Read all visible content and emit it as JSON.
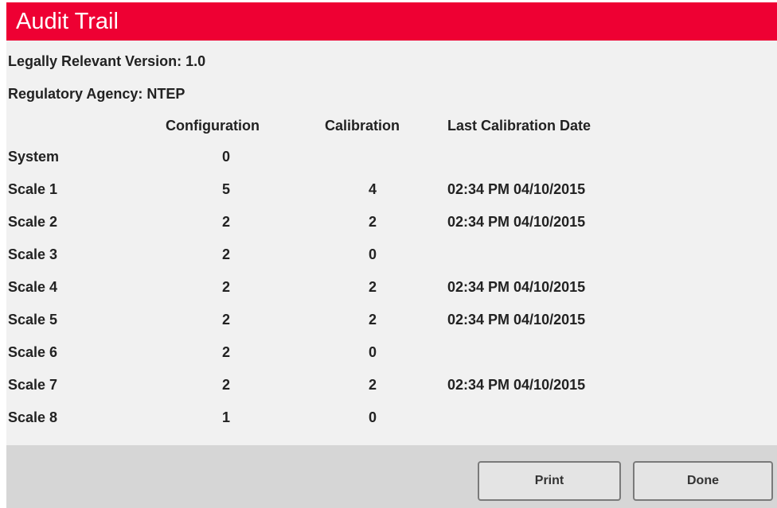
{
  "window": {
    "title": "Audit Trail"
  },
  "info": {
    "version_line": "Legally Relevant Version: 1.0",
    "agency_line": "Regulatory Agency: NTEP"
  },
  "table": {
    "headers": {
      "configuration": "Configuration",
      "calibration": "Calibration",
      "last_calibration_date": "Last Calibration Date"
    },
    "rows": [
      {
        "name": "System",
        "configuration": "0",
        "calibration": "",
        "date": ""
      },
      {
        "name": "Scale 1",
        "configuration": "5",
        "calibration": "4",
        "date": "02:34 PM 04/10/2015"
      },
      {
        "name": "Scale 2",
        "configuration": "2",
        "calibration": "2",
        "date": "02:34 PM 04/10/2015"
      },
      {
        "name": "Scale 3",
        "configuration": "2",
        "calibration": "0",
        "date": ""
      },
      {
        "name": "Scale 4",
        "configuration": "2",
        "calibration": "2",
        "date": "02:34 PM 04/10/2015"
      },
      {
        "name": "Scale 5",
        "configuration": "2",
        "calibration": "2",
        "date": "02:34 PM 04/10/2015"
      },
      {
        "name": "Scale 6",
        "configuration": "2",
        "calibration": "0",
        "date": ""
      },
      {
        "name": "Scale 7",
        "configuration": "2",
        "calibration": "2",
        "date": "02:34 PM 04/10/2015"
      },
      {
        "name": "Scale 8",
        "configuration": "1",
        "calibration": "0",
        "date": ""
      }
    ]
  },
  "footer": {
    "print_label": "Print",
    "done_label": "Done"
  },
  "colors": {
    "title_bar": "#ee0033",
    "panel": "#f1f1f1",
    "footer": "#d6d6d6"
  }
}
